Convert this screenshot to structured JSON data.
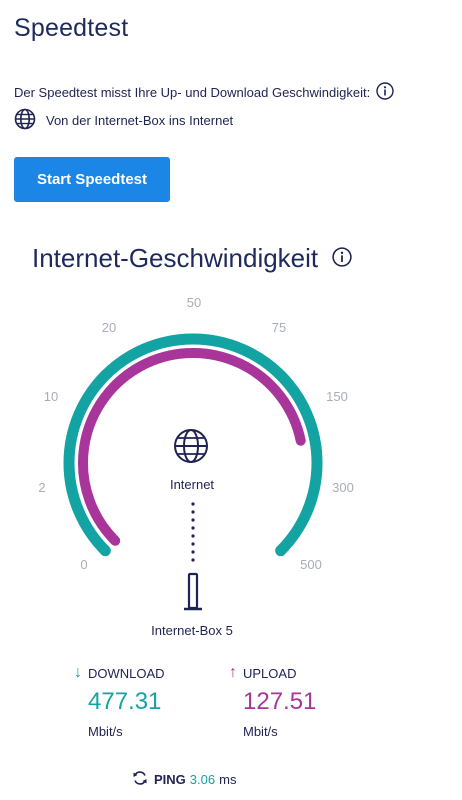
{
  "page": {
    "title": "Speedtest"
  },
  "intro": {
    "description": "Der Speedtest misst Ihre Up- und Download Geschwindigkeit:",
    "route": "Von der Internet-Box ins Internet"
  },
  "start_button": {
    "label": "Start Speedtest"
  },
  "section": {
    "title": "Internet-Geschwindigkeit"
  },
  "gauge": {
    "ticks": [
      "0",
      "2",
      "10",
      "20",
      "50",
      "75",
      "150",
      "300",
      "500"
    ],
    "center_label": "Internet",
    "device_label": "Internet-Box 5",
    "download_level": 1.0,
    "upload_level": 0.79,
    "colors": {
      "download": "#14a3a3",
      "upload": "#a8369a",
      "track": "#eeeeee"
    }
  },
  "download": {
    "label": "DOWNLOAD",
    "value": "477.31",
    "unit": "Mbit/s"
  },
  "upload": {
    "label": "UPLOAD",
    "value": "127.51",
    "unit": "Mbit/s"
  },
  "ping": {
    "label": "PING",
    "value": "3.06",
    "unit": "ms"
  }
}
